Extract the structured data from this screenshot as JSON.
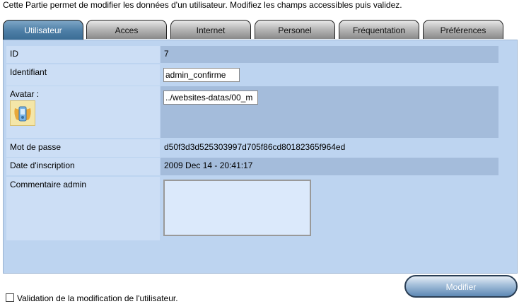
{
  "intro_text": "Cette Partie permet de modifier les données d'un utilisateur. Modifiez les champs accessibles puis validez.",
  "tabs": [
    {
      "label": "Utilisateur",
      "active": true
    },
    {
      "label": "Acces"
    },
    {
      "label": "Internet"
    },
    {
      "label": "Personel"
    },
    {
      "label": "Fréquentation"
    },
    {
      "label": "Préférences"
    }
  ],
  "form": {
    "id_label": "ID",
    "id_value": "7",
    "identifiant_label": "Identifiant",
    "identifiant_value": "admin_confirme",
    "avatar_label": "Avatar :",
    "avatar_path": "../websites-datas/00_m",
    "password_label": "Mot de passe",
    "password_value": "d50f3d3d525303997d705f86cd80182365f964ed",
    "inscription_label": "Date d'inscription",
    "inscription_value": "2009 Dec 14 - 20:41:17",
    "comment_label": "Commentaire admin",
    "comment_value": ""
  },
  "validation_label": "Validation de la modification de l'utilisateur.",
  "modify_button": "Modifier",
  "colors": {
    "panel": "#bdd4f0",
    "label_cell": "#ccdef5",
    "value_cell": "#a4bcdb",
    "active_tab": "#4d7ea6"
  }
}
